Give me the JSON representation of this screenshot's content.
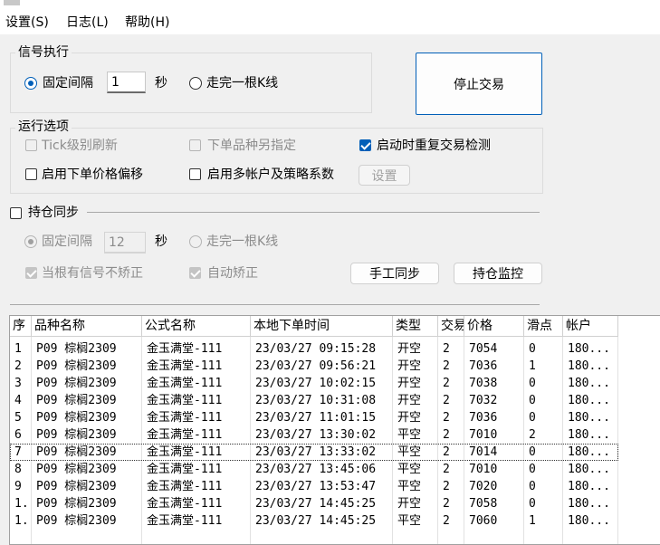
{
  "menu": {
    "settings": "设置(S)",
    "log": "日志(L)",
    "help": "帮助(H)"
  },
  "signal": {
    "title": "信号执行",
    "fixed_interval": "固定间隔",
    "interval_value": "1",
    "seconds": "秒",
    "kline": "走完一根K线"
  },
  "stop_button": "停止交易",
  "run_options": {
    "title": "运行选项",
    "tick_refresh": "Tick级别刷新",
    "order_variety": "下单品种另指定",
    "startup_check": "启动时重复交易检测",
    "price_offset": "启用下单价格偏移",
    "multi_account": "启用多帐户及策略系数",
    "settings_button": "设置"
  },
  "sync": {
    "title": "持仓同步",
    "fixed_interval": "固定间隔",
    "interval_value": "12",
    "seconds": "秒",
    "kline": "走完一根K线",
    "no_fix": "当根有信号不矫正",
    "auto_fix": "自动矫正",
    "manual_sync_button": "手工同步",
    "monitor_button": "持仓监控"
  },
  "table": {
    "columns": [
      "序",
      "品种名称",
      "公式名称",
      "本地下单时间",
      "类型",
      "交易数",
      "价格",
      "滑点",
      "帐户"
    ],
    "rows": [
      [
        "1",
        "P09 棕榈2309",
        "金玉满堂-111",
        "23/03/27 09:15:28",
        "开空",
        "2",
        "7054",
        "0",
        "180..."
      ],
      [
        "2",
        "P09 棕榈2309",
        "金玉满堂-111",
        "23/03/27 09:56:21",
        "开空",
        "2",
        "7036",
        "1",
        "180..."
      ],
      [
        "3",
        "P09 棕榈2309",
        "金玉满堂-111",
        "23/03/27 10:02:15",
        "开空",
        "2",
        "7038",
        "0",
        "180..."
      ],
      [
        "4",
        "P09 棕榈2309",
        "金玉满堂-111",
        "23/03/27 10:31:08",
        "开空",
        "2",
        "7032",
        "0",
        "180..."
      ],
      [
        "5",
        "P09 棕榈2309",
        "金玉满堂-111",
        "23/03/27 11:01:15",
        "开空",
        "2",
        "7036",
        "0",
        "180..."
      ],
      [
        "6",
        "P09 棕榈2309",
        "金玉满堂-111",
        "23/03/27 13:30:02",
        "平空",
        "2",
        "7010",
        "2",
        "180..."
      ],
      [
        "7",
        "P09 棕榈2309",
        "金玉满堂-111",
        "23/03/27 13:33:02",
        "平空",
        "2",
        "7014",
        "0",
        "180..."
      ],
      [
        "8",
        "P09 棕榈2309",
        "金玉满堂-111",
        "23/03/27 13:45:06",
        "平空",
        "2",
        "7010",
        "0",
        "180..."
      ],
      [
        "9",
        "P09 棕榈2309",
        "金玉满堂-111",
        "23/03/27 13:53:47",
        "平空",
        "2",
        "7020",
        "0",
        "180..."
      ],
      [
        "1.",
        "P09 棕榈2309",
        "金玉满堂-111",
        "23/03/27 14:45:25",
        "开空",
        "2",
        "7058",
        "0",
        "180..."
      ],
      [
        "1.",
        "P09 棕榈2309",
        "金玉满堂-111",
        "23/03/27 14:45:25",
        "平空",
        "2",
        "7060",
        "1",
        "180..."
      ]
    ]
  }
}
